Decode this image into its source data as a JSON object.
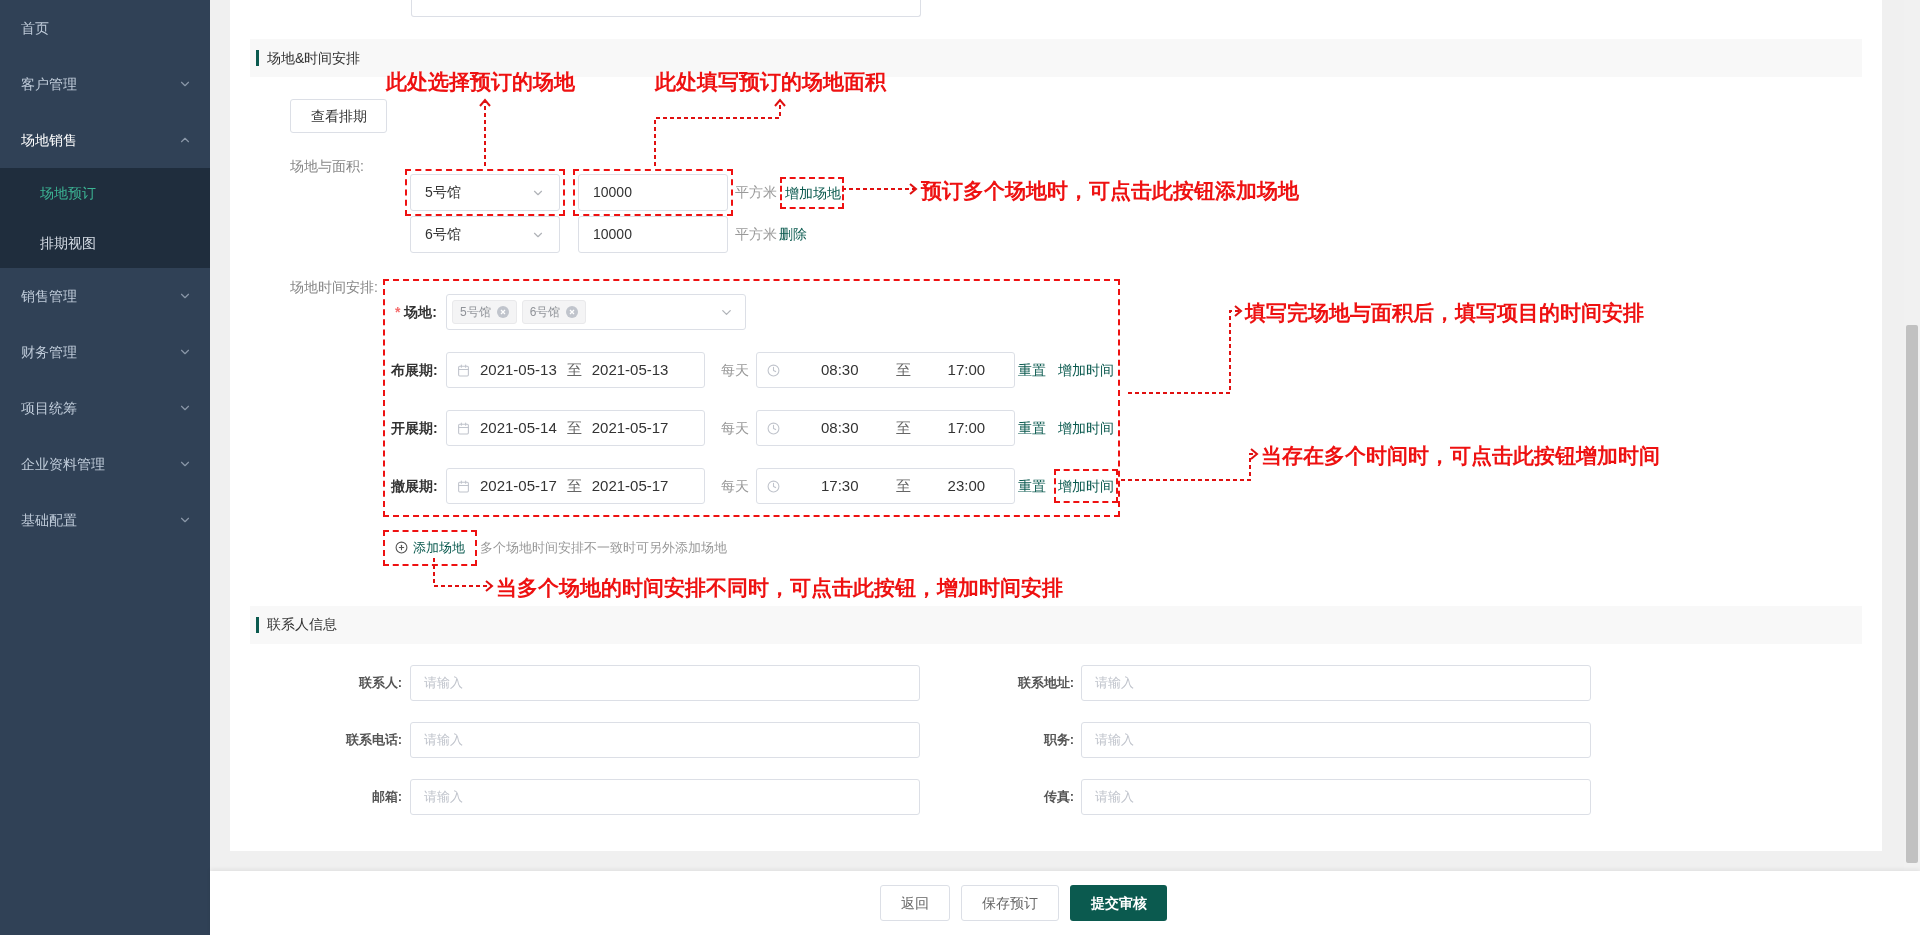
{
  "sidebar": {
    "items": [
      {
        "label": "首页",
        "kind": "link"
      },
      {
        "label": "客户管理",
        "kind": "group",
        "expanded": false
      },
      {
        "label": "场地销售",
        "kind": "group",
        "expanded": true,
        "children": [
          {
            "label": "场地预订",
            "selected": true
          },
          {
            "label": "排期视图",
            "selected": false
          }
        ]
      },
      {
        "label": "销售管理",
        "kind": "group",
        "expanded": false
      },
      {
        "label": "财务管理",
        "kind": "group",
        "expanded": false
      },
      {
        "label": "项目统筹",
        "kind": "group",
        "expanded": false
      },
      {
        "label": "企业资料管理",
        "kind": "group",
        "expanded": false
      },
      {
        "label": "基础配置",
        "kind": "group",
        "expanded": false
      }
    ]
  },
  "venue_section": {
    "title": "场地&时间安排",
    "view_schedule_button": "查看排期",
    "venue_area_label": "场地与面积:",
    "venues": [
      {
        "hall": "5号馆",
        "area": "10000",
        "unit": "平方米",
        "action": "增加场地",
        "highlighted": true
      },
      {
        "hall": "6号馆",
        "area": "10000",
        "unit": "平方米",
        "action": "删除",
        "highlighted": false
      }
    ],
    "time_label": "场地时间安排:",
    "time_block_highlighted": true,
    "venue_select": {
      "required_mark": "*",
      "label": "场地:",
      "tags": [
        "5号馆",
        "6号馆"
      ]
    },
    "periods": [
      {
        "label": "布展期:",
        "start_date": "2021-05-13",
        "date_sep": "至",
        "end_date": "2021-05-13",
        "daily": "每天",
        "start_time": "08:30",
        "time_sep": "至",
        "end_time": "17:00",
        "reset": "重置",
        "add_time": "增加时间",
        "highlighted": false
      },
      {
        "label": "开展期:",
        "start_date": "2021-05-14",
        "date_sep": "至",
        "end_date": "2021-05-17",
        "daily": "每天",
        "start_time": "08:30",
        "time_sep": "至",
        "end_time": "17:00",
        "reset": "重置",
        "add_time": "增加时间",
        "highlighted": false
      },
      {
        "label": "撤展期:",
        "start_date": "2021-05-17",
        "date_sep": "至",
        "end_date": "2021-05-17",
        "daily": "每天",
        "start_time": "17:30",
        "time_sep": "至",
        "end_time": "23:00",
        "reset": "重置",
        "add_time": "增加时间",
        "highlighted": true
      }
    ],
    "add_venue_button": "添加场地",
    "add_venue_highlighted": true,
    "add_venue_hint": "多个场地时间安排不一致时可另外添加场地"
  },
  "contact_section": {
    "title": "联系人信息",
    "fields": [
      {
        "label": "联系人:",
        "placeholder": "请输入"
      },
      {
        "label": "联系地址:",
        "placeholder": "请输入"
      },
      {
        "label": "联系电话:",
        "placeholder": "请输入"
      },
      {
        "label": "职务:",
        "placeholder": "请输入"
      },
      {
        "label": "邮箱:",
        "placeholder": "请输入"
      },
      {
        "label": "传真:",
        "placeholder": "请输入"
      }
    ]
  },
  "footer_buttons": [
    {
      "label": "返回",
      "kind": "default"
    },
    {
      "label": "保存预订",
      "kind": "default"
    },
    {
      "label": "提交审核",
      "kind": "primary"
    }
  ],
  "annotations": [
    {
      "text": "此处选择预订的场地"
    },
    {
      "text": "此处填写预订的场地面积"
    },
    {
      "text": "预订多个场地时，可点击此按钮添加场地"
    },
    {
      "text": "填写完场地与面积后，填写项目的时间安排"
    },
    {
      "text": "当存在多个时间时，可点击此按钮增加时间"
    },
    {
      "text": "当多个场地的时间安排不同时，可点击此按钮，增加时间安排"
    }
  ]
}
